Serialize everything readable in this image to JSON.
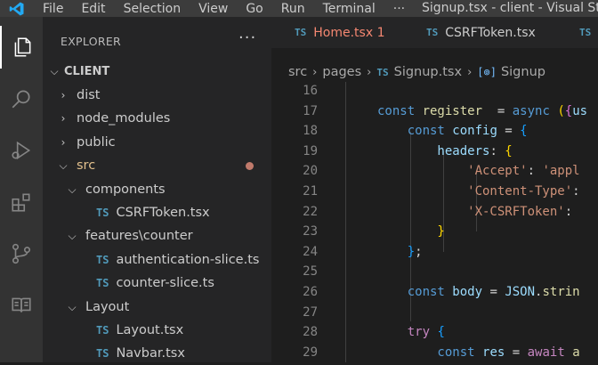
{
  "titlebar": {
    "menu": [
      "File",
      "Edit",
      "Selection",
      "View",
      "Go",
      "Run",
      "Terminal",
      "···"
    ],
    "title": "Signup.tsx - client - Visual Studio Code"
  },
  "sidebar": {
    "header": "EXPLORER",
    "more": "···",
    "root": "CLIENT",
    "items": [
      {
        "label": "dist",
        "type": "folder",
        "expanded": false
      },
      {
        "label": "node_modules",
        "type": "folder",
        "expanded": false
      },
      {
        "label": "public",
        "type": "folder",
        "expanded": false
      },
      {
        "label": "src",
        "type": "folder",
        "expanded": true
      },
      {
        "label": "components",
        "type": "folder",
        "expanded": true
      },
      {
        "label": "CSRFToken.tsx",
        "type": "file"
      },
      {
        "label": "features\\counter",
        "type": "folder",
        "expanded": true
      },
      {
        "label": "authentication-slice.ts",
        "type": "file"
      },
      {
        "label": "counter-slice.ts",
        "type": "file"
      },
      {
        "label": "Layout",
        "type": "folder",
        "expanded": true
      },
      {
        "label": "Layout.tsx",
        "type": "file"
      },
      {
        "label": "Navbar.tsx",
        "type": "file"
      }
    ],
    "ts_badge": "TS",
    "modified_color": "#c07a6b"
  },
  "tabs": [
    {
      "label": "Home.tsx 1",
      "badge": "TS",
      "color": "#f48771"
    },
    {
      "label": "CSRFToken.tsx",
      "badge": "TS",
      "color": "#cccccc"
    },
    {
      "label": "",
      "badge": "TS",
      "color": "#cccccc"
    }
  ],
  "breadcrumb": {
    "parts": [
      "src",
      "pages",
      "Signup.tsx",
      "Signup"
    ],
    "ts_badge": "TS",
    "symbol_icon": "[⊚]"
  },
  "editor": {
    "line_numbers": [
      "16",
      "17",
      "18",
      "19",
      "20",
      "21",
      "22",
      "23",
      "24",
      "25",
      "26",
      "27",
      "28",
      "29"
    ],
    "lines": [
      {
        "tokens": []
      },
      {
        "tokens": [
          [
            "kw",
            "const "
          ],
          [
            "fn",
            "register"
          ],
          [
            "",
            "  = "
          ],
          [
            "kw",
            "async "
          ],
          [
            "br1",
            "("
          ],
          [
            "br2",
            "{"
          ],
          [
            "var",
            "us"
          ]
        ]
      },
      {
        "tokens": [
          [
            "kw",
            "    const "
          ],
          [
            "var",
            "config"
          ],
          [
            "",
            " = "
          ],
          [
            "br3",
            "{"
          ]
        ]
      },
      {
        "tokens": [
          [
            "var",
            "        headers"
          ],
          [
            "",
            ": "
          ],
          [
            "br1",
            "{"
          ]
        ]
      },
      {
        "tokens": [
          [
            "str",
            "            'Accept'"
          ],
          [
            "",
            ": "
          ],
          [
            "str",
            "'appl"
          ]
        ]
      },
      {
        "tokens": [
          [
            "str",
            "            'Content-Type'"
          ],
          [
            "",
            ":"
          ]
        ]
      },
      {
        "tokens": [
          [
            "str",
            "            'X-CSRFToken'"
          ],
          [
            "",
            ": "
          ]
        ]
      },
      {
        "tokens": [
          [
            "br1",
            "        }"
          ]
        ]
      },
      {
        "tokens": [
          [
            "br3",
            "    }"
          ],
          [
            "",
            ";"
          ]
        ]
      },
      {
        "tokens": []
      },
      {
        "tokens": [
          [
            "kw",
            "    const "
          ],
          [
            "var",
            "body"
          ],
          [
            "",
            " = "
          ],
          [
            "var",
            "JSON"
          ],
          [
            "",
            "."
          ],
          [
            "fn",
            "strin"
          ]
        ]
      },
      {
        "tokens": []
      },
      {
        "tokens": [
          [
            "kw2",
            "    try "
          ],
          [
            "br3",
            "{"
          ]
        ]
      },
      {
        "tokens": [
          [
            "kw",
            "        const "
          ],
          [
            "var",
            "res"
          ],
          [
            "",
            " = "
          ],
          [
            "kw2",
            "await "
          ],
          [
            "fn",
            "a"
          ]
        ]
      }
    ]
  }
}
